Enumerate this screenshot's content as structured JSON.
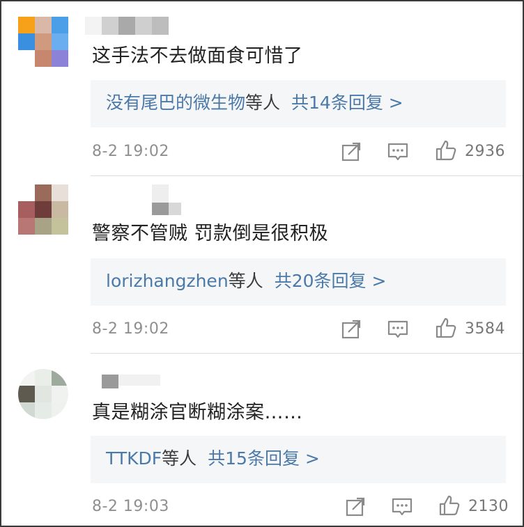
{
  "comments": [
    {
      "text": "这手法不去做面食可惜了",
      "reply_users": "没有尾巴的微生物",
      "reply_mid": "等人",
      "reply_count": "共14条回复 >",
      "time": "8-2 19:02",
      "likes": "2936"
    },
    {
      "text": "警察不管贼 罚款倒是很积极",
      "reply_users": "lorizhangzhen",
      "reply_mid": "等人",
      "reply_count": "共20条回复 >",
      "time": "8-2 19:02",
      "likes": "3584"
    },
    {
      "text": "真是糊涂官断糊涂案……",
      "reply_users": "TTKDF",
      "reply_mid": "等人",
      "reply_count": "共15条回复 >",
      "time": "8-2 19:03",
      "likes": "2130"
    }
  ],
  "icons": {
    "share": "share-icon",
    "comment": "comment-icon",
    "like": "thumbs-up-icon"
  },
  "colors": {
    "link": "#4b79a8",
    "meta": "#8f8f8f",
    "reply_bg": "#f5f6f8"
  }
}
